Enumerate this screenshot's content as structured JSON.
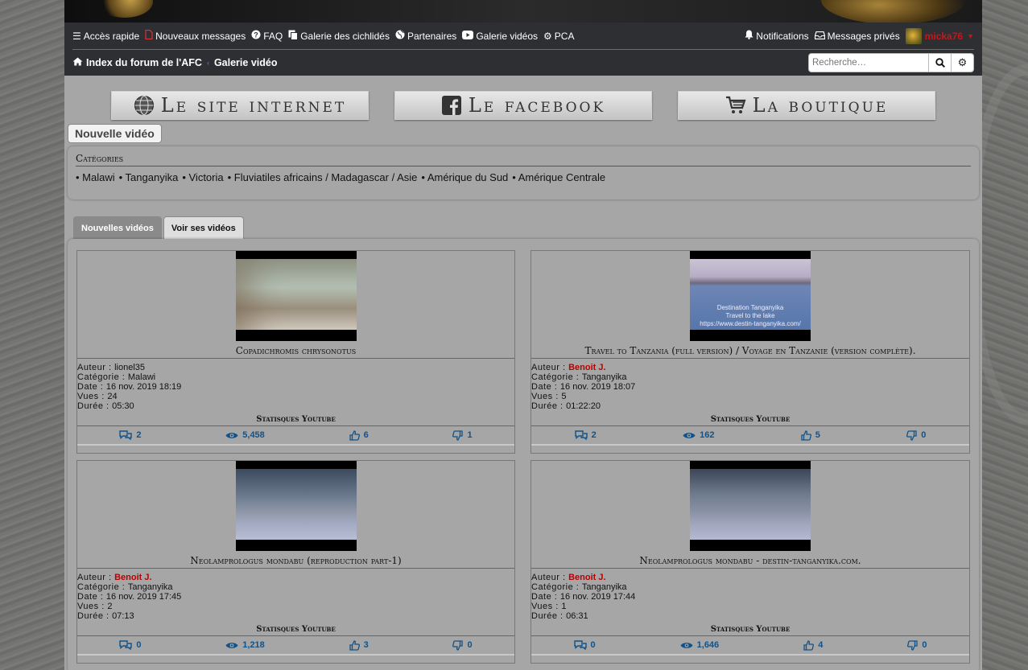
{
  "nav": {
    "quick_access": "Accès rapide",
    "new_messages": "Nouveaux messages",
    "faq": "FAQ",
    "gallery_cichlids": "Galerie des cichlidés",
    "partners": "Partenaires",
    "video_gallery": "Galerie vidéos",
    "pca": "PCA",
    "notifications": "Notifications",
    "private_messages": "Messages privés",
    "username": "micka76"
  },
  "breadcrumb": {
    "home": "Index du forum de l'AFC",
    "current": "Galerie vidéo"
  },
  "search": {
    "placeholder": "Recherche…"
  },
  "banner_buttons": {
    "site": "Le site internet",
    "facebook": "Le facebook",
    "shop": "La boutique"
  },
  "new_video_button": "Nouvelle vidéo",
  "categories": {
    "title": "Catégories",
    "items": [
      "• Malawi",
      "• Tanganyika",
      "• Victoria",
      "• Fluviatiles africains / Madagascar / Asie",
      "• Amérique du Sud",
      "• Amérique Centrale"
    ]
  },
  "tabs": {
    "new_videos": "Nouvelles vidéos",
    "my_videos": "Voir ses vidéos"
  },
  "labels": {
    "author": "Auteur : ",
    "category": "Catégorie : ",
    "date": "Date : ",
    "views": "Vues : ",
    "duration": "Durée : ",
    "yt_stats": "Statisques Youtube"
  },
  "videos": [
    {
      "title": "Copadichromis chrysonotus",
      "author": "lionel35",
      "category": "Malawi",
      "date": "16 nov. 2019 18:19",
      "views": "24",
      "duration": "05:30",
      "comments": "2",
      "yt_views": "5,458",
      "likes": "6",
      "dislikes": "1",
      "thumb_caption": ""
    },
    {
      "title": "Travel to Tanzania (full version) / Voyage en Tanzanie (version complète).",
      "author": "Benoit J.",
      "category": "Tanganyika",
      "date": "16 nov. 2019 18:07",
      "views": "5",
      "duration": "01:22:20",
      "comments": "2",
      "yt_views": "162",
      "likes": "5",
      "dislikes": "0",
      "thumb_caption": "Destination Tanganyika\nTravel to the lake\nhttps://www.destin-tanganyika.com/"
    },
    {
      "title": "Neolamprologus mondabu (reproduction part-1)",
      "author": "Benoit J.",
      "category": "Tanganyika",
      "date": "16 nov. 2019 17:45",
      "views": "2",
      "duration": "07:13",
      "comments": "0",
      "yt_views": "1,218",
      "likes": "3",
      "dislikes": "0",
      "thumb_caption": ""
    },
    {
      "title": "Neolamprologus mondabu - destin-tanganyika.com.",
      "author": "Benoit J.",
      "category": "Tanganyika",
      "date": "16 nov. 2019 17:44",
      "views": "1",
      "duration": "06:31",
      "comments": "0",
      "yt_views": "1,646",
      "likes": "4",
      "dislikes": "0",
      "thumb_caption": ""
    }
  ]
}
